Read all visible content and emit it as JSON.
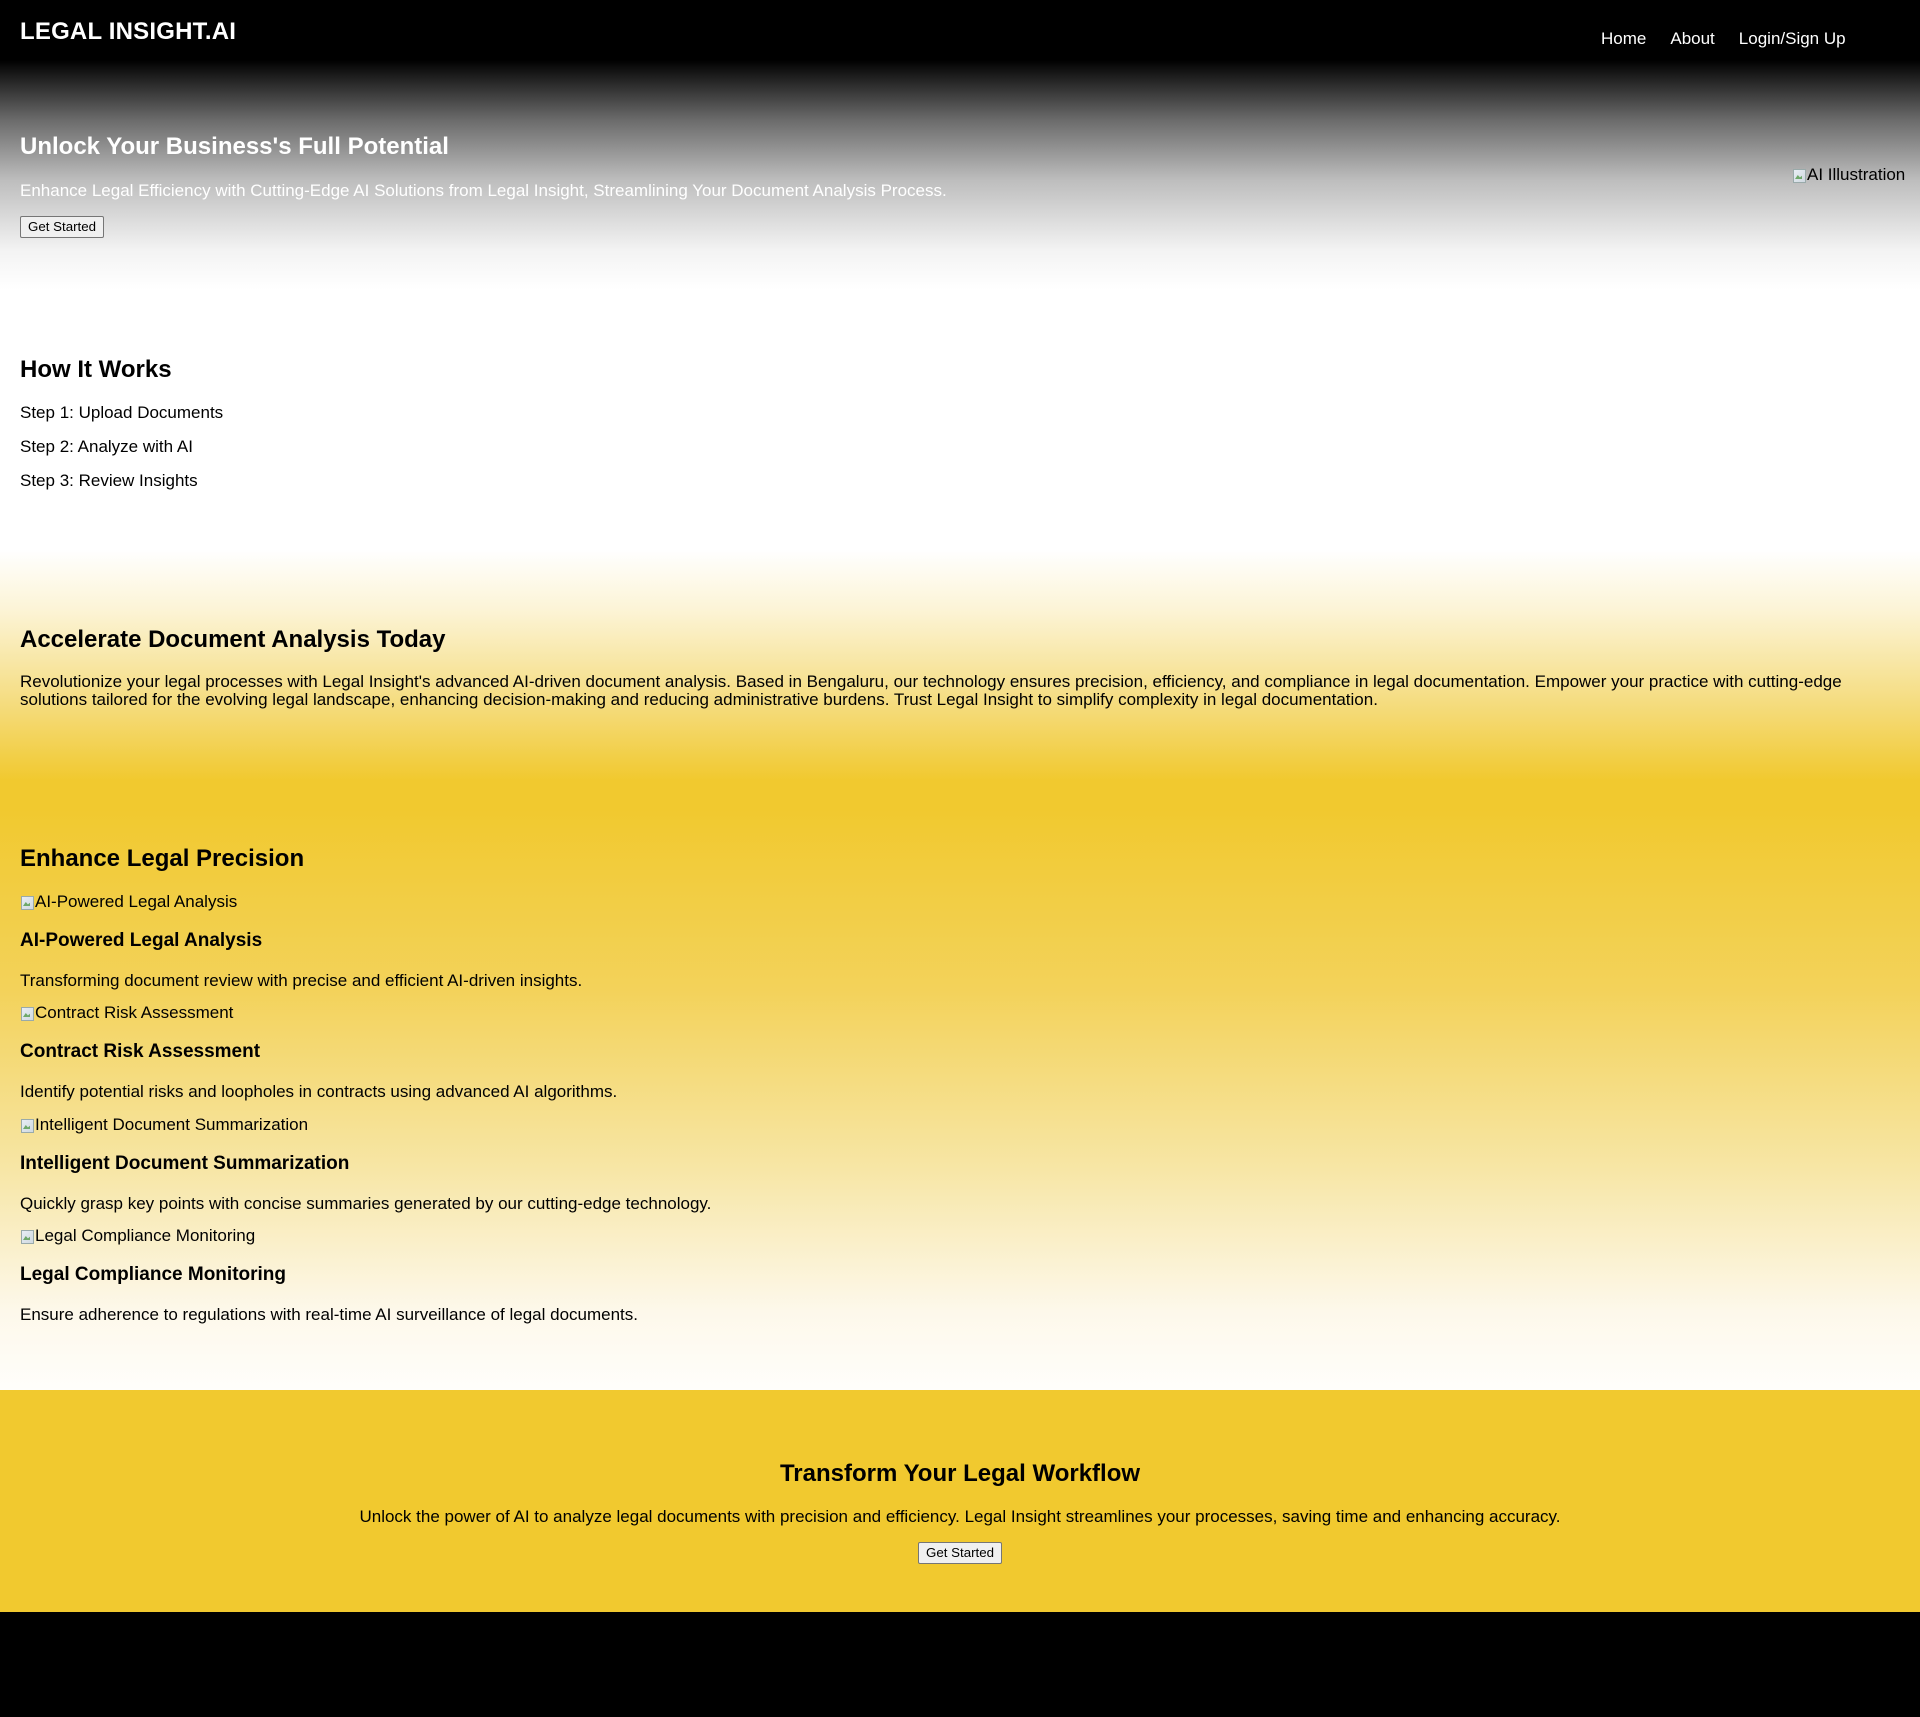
{
  "header": {
    "logo": "LEGAL INSIGHT.AI",
    "nav": {
      "home": "Home",
      "about": "About",
      "login": "Login/Sign Up"
    }
  },
  "hero": {
    "title": "Unlock Your Business's Full Potential",
    "subtitle": "Enhance Legal Efficiency with Cutting-Edge AI Solutions from Legal Insight, Streamlining Your Document Analysis Process.",
    "button_label": "Get Started",
    "image_alt": "AI Illustration"
  },
  "how_it_works": {
    "title": "How It Works",
    "steps": [
      "Step 1: Upload Documents",
      "Step 2: Analyze with AI",
      "Step 3: Review Insights"
    ]
  },
  "accelerate": {
    "title": "Accelerate Document Analysis Today",
    "body": "Revolutionize your legal processes with Legal Insight's advanced AI-driven document analysis. Based in Bengaluru, our technology ensures precision, efficiency, and compliance in legal documentation. Empower your practice with cutting-edge solutions tailored for the evolving legal landscape, enhancing decision-making and reducing administrative burdens. Trust Legal Insight to simplify complexity in legal documentation."
  },
  "enhance": {
    "title": "Enhance Legal Precision",
    "features": [
      {
        "image_alt": "AI-Powered Legal Analysis",
        "title": "AI-Powered Legal Analysis",
        "description": "Transforming document review with precise and efficient AI-driven insights."
      },
      {
        "image_alt": "Contract Risk Assessment",
        "title": "Contract Risk Assessment",
        "description": "Identify potential risks and loopholes in contracts using advanced AI algorithms."
      },
      {
        "image_alt": "Intelligent Document Summarization",
        "title": "Intelligent Document Summarization",
        "description": "Quickly grasp key points with concise summaries generated by our cutting-edge technology."
      },
      {
        "image_alt": "Legal Compliance Monitoring",
        "title": "Legal Compliance Monitoring",
        "description": "Ensure adherence to regulations with real-time AI surveillance of legal documents."
      }
    ]
  },
  "cta": {
    "title": "Transform Your Legal Workflow",
    "body": "Unlock the power of AI to analyze legal documents with precision and efficiency. Legal Insight streamlines your processes, saving time and enhancing accuracy.",
    "button_label": "Get Started"
  },
  "colors": {
    "header_bg": "#000000",
    "accent_yellow": "#f1c92f",
    "footer_bg": "#000000"
  }
}
